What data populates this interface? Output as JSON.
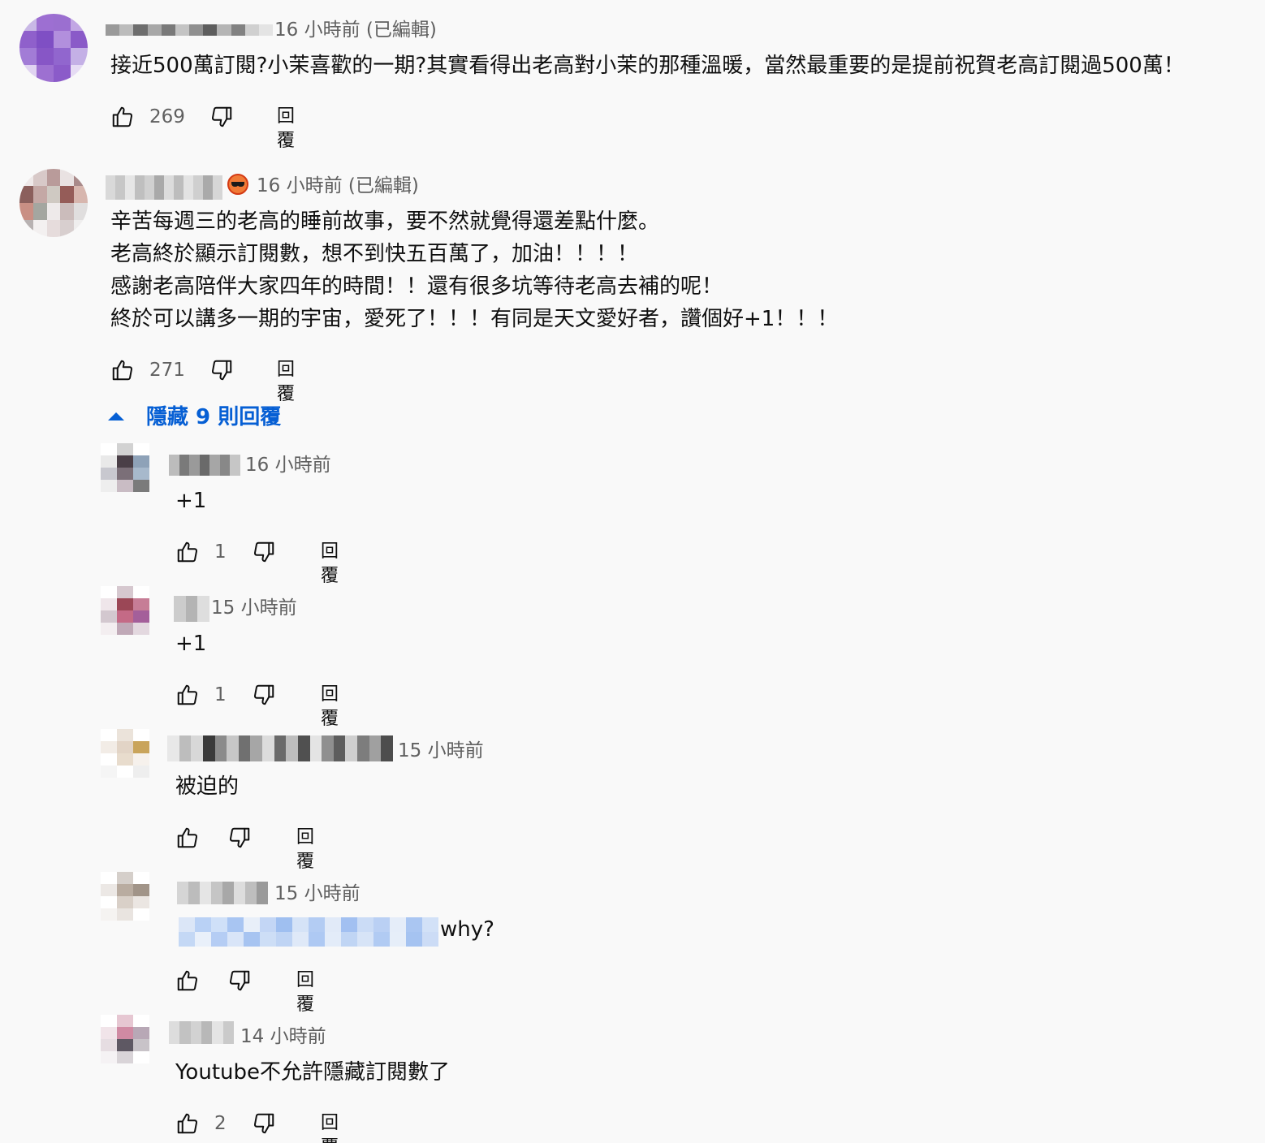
{
  "comments": [
    {
      "meta": "16 小時前 (已編輯)",
      "text": "接近500萬訂閱?小茉喜歡的一期?其實看得出老高對小茉的那種溫暖，當然最重要的是提前祝賀老高訂閱過500萬！",
      "likes": "269",
      "reply_label": "回覆",
      "avatar_colors": [
        "#c9b8e6",
        "#9d6fd2",
        "#9b6fd0",
        "#c2a7e4",
        "#8f60cb",
        "#7f4fc4",
        "#b28fdd",
        "#8a5ac8",
        "#a27cd6",
        "#8756c6",
        "#9166ce",
        "#c4b0e6",
        "#e0d3f1",
        "#9d70d1",
        "#8b5bc9",
        "#e6dcf4"
      ],
      "name_colors": [
        "#9a9a9a",
        "#bcbcbc",
        "#6e6e6e",
        "#a8a8a8",
        "#7a7a7a",
        "#c4c4c4",
        "#909090",
        "#5e5e5e",
        "#b5b5b5",
        "#828282",
        "#d0d0d0",
        "#e4e4e4"
      ]
    },
    {
      "meta": "16 小時前 (已編輯)",
      "text_lines": [
        "辛苦每週三的老高的睡前故事，要不然就覺得還差點什麼。",
        "老高終於顯示訂閱數，想不到快五百萬了，加油！！！！",
        "感謝老高陪伴大家四年的時間！！還有很多坑等待老高去補的呢！",
        "終於可以講多一期的宇宙，愛死了！！！有同是天文愛好者，讚個好+1！！！"
      ],
      "likes": "271",
      "reply_label": "回覆",
      "avatar_colors": [
        "#efe9e9",
        "#d8c9c8",
        "#b99b9a",
        "#e9e2e2",
        "#a98a8a",
        "#8b5f5c",
        "#c4a8a5",
        "#cfc9c2",
        "#955c58",
        "#d7b6ae",
        "#c98f84",
        "#a4a6a0",
        "#eeeaea",
        "#cbbcbb",
        "#e0dede",
        "#b8b2b2",
        "#f3f0f0",
        "#e6dcdc",
        "#d8cfcf",
        "#efeeee"
      ],
      "name_colors": [
        "#d9d9d9",
        "#c7c7c7",
        "#e6e6e6",
        "#bfbfbf",
        "#d0d0d0",
        "#a9a9a9",
        "#dcdcdc",
        "#bdbdbd",
        "#e3e3e3",
        "#cfcfcf",
        "#aaaaaa",
        "#d6d6d6"
      ]
    }
  ],
  "toggle_label": "隱藏 9 則回覆",
  "replies": [
    {
      "meta": "16 小時前",
      "text": "+1",
      "likes": "1",
      "reply_label": "回覆",
      "avatar_colors": [
        "#ffffff",
        "#d2d2d2",
        "#ffffff",
        "#e9e9e9",
        "#4a3f47",
        "#8ea2b8",
        "#c8c8cf",
        "#7b6f78",
        "#a7b9cc",
        "#eeeeee",
        "#c9bcc4",
        "#7b7b7b"
      ],
      "name_colors": [
        "#bcbcbc",
        "#7a7a7a",
        "#9a9a9a",
        "#6a6a6a",
        "#a6a6a6",
        "#888888",
        "#c6c6c6"
      ]
    },
    {
      "meta": "15 小時前",
      "text": "+1",
      "likes": "1",
      "reply_label": "回覆",
      "avatar_colors": [
        "#ffffff",
        "#d6c8cf",
        "#ffffff",
        "#efe6ea",
        "#9b4756",
        "#c67d96",
        "#d3c8cf",
        "#c46a86",
        "#a45f9a",
        "#f3eef0",
        "#c0a9b7",
        "#e3d8df"
      ],
      "name_colors": [
        "#cccccc",
        "#b4b4b4",
        "#dedede"
      ]
    },
    {
      "meta": "15 小時前",
      "text": "被迫的",
      "likes": "",
      "reply_label": "回覆",
      "avatar_colors": [
        "#ffffff",
        "#ebe3da",
        "#ffffff",
        "#f2ece6",
        "#e2d4c6",
        "#c9a45b",
        "#ffffff",
        "#e8dccd",
        "#f6f1ec",
        "#f5f5f5",
        "#ffffff",
        "#eeeeee"
      ],
      "name_colors": [
        "#e8e8e8",
        "#bdbdbd",
        "#d8d8d8",
        "#3a3a3a",
        "#8b8b8b",
        "#c7c7c7",
        "#707070",
        "#a6a6a6",
        "#dcdcdc",
        "#6a6a6a",
        "#bdbdbd",
        "#505050",
        "#e4e4e4",
        "#8f8f8f",
        "#5d5d5d",
        "#cfcfcf",
        "#7d7d7d",
        "#a0a0a0",
        "#4d4d4d"
      ]
    },
    {
      "meta": "15 小時前",
      "text": "why?",
      "likes": "",
      "reply_label": "回覆",
      "avatar_colors": [
        "#ffffff",
        "#d5cfca",
        "#ffffff",
        "#ece8e5",
        "#b9aca0",
        "#a19488",
        "#ffffff",
        "#d9d0c8",
        "#ebe6e2",
        "#f5f3f1",
        "#e9e4e0",
        "#ffffff"
      ],
      "name_colors": [
        "#d5d5d5",
        "#bcbcbc",
        "#e5e5e5",
        "#c5c5c5",
        "#a8a8a8",
        "#dddddd",
        "#bebebe",
        "#9a9a9a"
      ],
      "mention_colors": [
        "#dbe6f7",
        "#b9d1f5",
        "#cfe0f8",
        "#a8c5f2",
        "#e8eff9",
        "#c3d6f5",
        "#9fbff0",
        "#d5e3f7",
        "#b3ccf3",
        "#e1eaf8",
        "#a2c0f1",
        "#cbdcf6",
        "#bad0f4",
        "#e5edf9",
        "#aac6f2",
        "#d2e1f7",
        "#c4d8f5",
        "#e9f0fa",
        "#b5cdf4",
        "#d9e5f8",
        "#a7c4f1",
        "#cddef6",
        "#bfd4f4",
        "#dfe9f8",
        "#aec9f3",
        "#e3ecf9",
        "#c0d5f4",
        "#d7e4f7",
        "#b1cbf3",
        "#e6eef9",
        "#a5c3f1",
        "#ccdcf6"
      ]
    },
    {
      "meta": "14 小時前",
      "text": "Youtube不允許隱藏訂閱數了",
      "likes": "2",
      "reply_label": "回覆",
      "avatar_colors": [
        "#ffffff",
        "#e6c7d2",
        "#ffffff",
        "#f1e4e9",
        "#d08aa3",
        "#b8a8b6",
        "#e6dde2",
        "#5e5863",
        "#c8c3c8",
        "#f5f2f4",
        "#d9d4d8",
        "#ffffff"
      ],
      "name_colors": [
        "#dddddd",
        "#c2c2c2",
        "#d2d2d2",
        "#b8b8b8",
        "#e4e4e4",
        "#cacaca"
      ]
    }
  ]
}
